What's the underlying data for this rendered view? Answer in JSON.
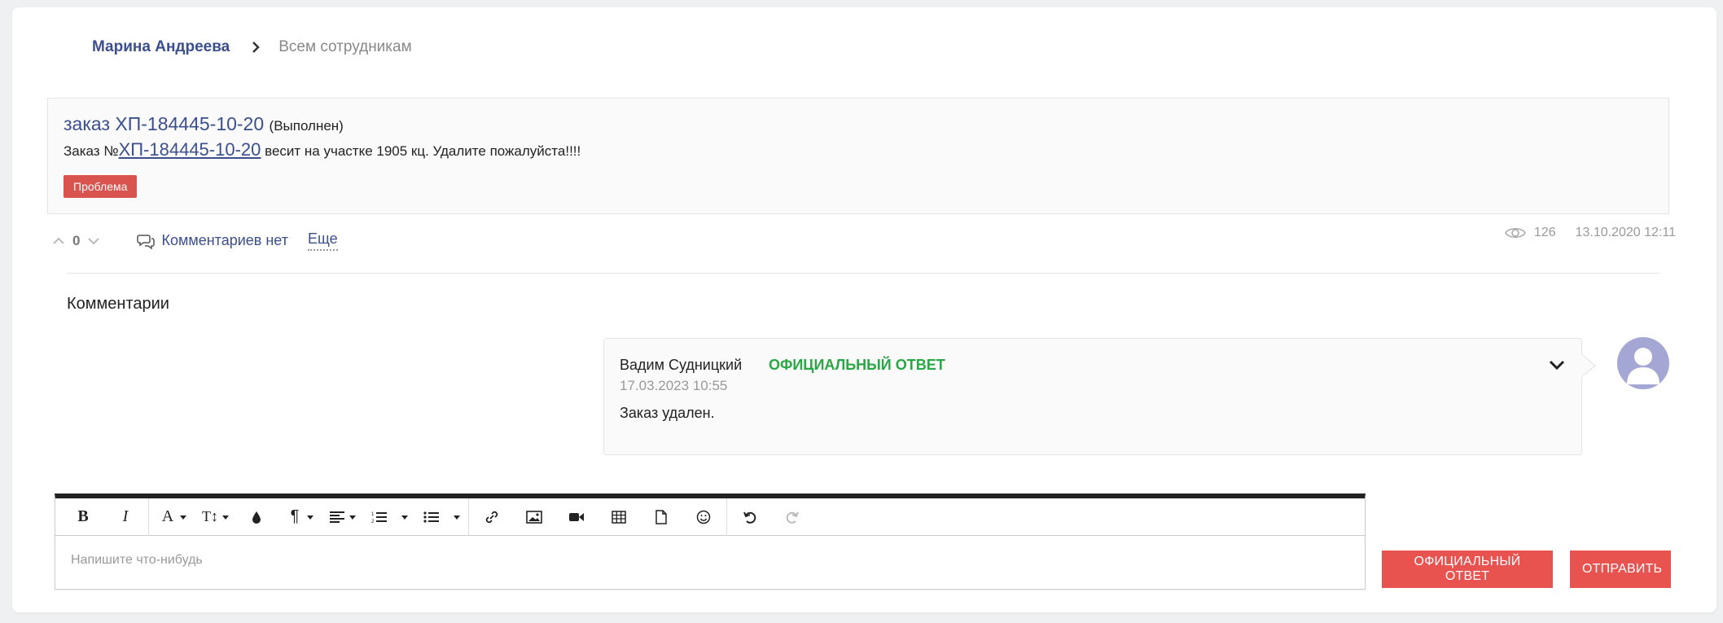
{
  "breadcrumb": {
    "author": "Марина Андреева",
    "target": "Всем сотрудникам"
  },
  "post": {
    "title": "заказ ХП-184445-10-20",
    "status": "(Выполнен)",
    "body_prefix": "Заказ №",
    "order_link": "ХП-184445-10-20",
    "body_suffix": " весит на участке 1905 кц. Удалите пожалуйста!!!!",
    "tag": "Проблема",
    "tag_color": "#d9534f"
  },
  "actions": {
    "vote_count": "0",
    "comments_label": "Комментариев нет",
    "more_label": "Еще"
  },
  "meta": {
    "views": "126",
    "datetime": "13.10.2020 12:11"
  },
  "comments_section": {
    "title": "Комментарии",
    "items": [
      {
        "author": "Вадим Судницкий",
        "badge": "ОФИЦИАЛЬНЫЙ ОТВЕТ",
        "date": "17.03.2023 10:55",
        "text": "Заказ удален."
      }
    ]
  },
  "editor": {
    "placeholder": "Напишите что-нибудь",
    "toolbar": [
      "bold-icon",
      "italic-icon",
      "font-color-icon",
      "font-size-icon",
      "fill-color-icon",
      "paragraph-icon",
      "align-icon",
      "ordered-list-icon",
      "unordered-list-icon",
      "link-icon",
      "image-icon",
      "video-icon",
      "table-icon",
      "file-icon",
      "emoji-icon",
      "undo-icon",
      "redo-icon"
    ]
  },
  "buttons": {
    "official_reply": "ОФИЦИАЛЬНЫЙ ОТВЕТ",
    "send": "ОТПРАВИТЬ"
  },
  "colors": {
    "accent_blue": "#3b4f8f",
    "button_red": "#e8524f",
    "official_green": "#28a745",
    "avatar_bg": "#a4a6d3"
  }
}
